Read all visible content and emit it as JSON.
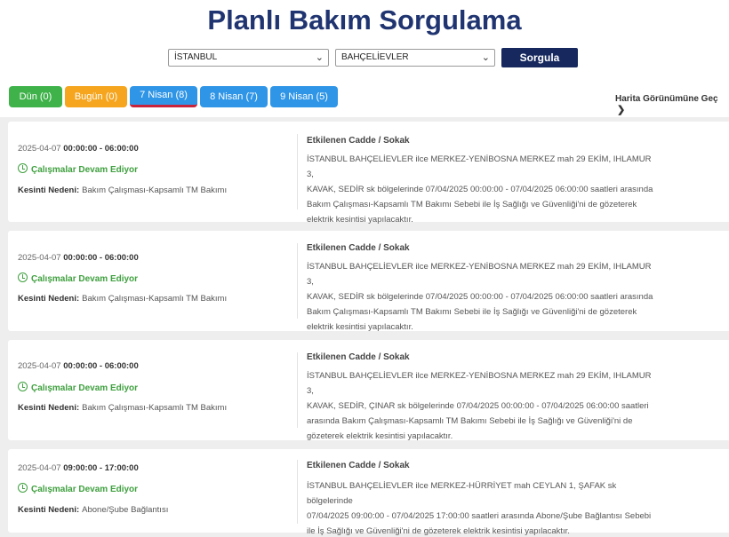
{
  "header": {
    "title": "Planlı Bakım Sorgulama",
    "city_select": "İSTANBUL",
    "district_select": "BAHÇELİEVLER",
    "query_button": "Sorgula"
  },
  "tabs": [
    {
      "label": "Dün (0)",
      "color": "#3fb24a"
    },
    {
      "label": "Bugün (0)",
      "color": "#f5a51e"
    },
    {
      "label": "7 Nisan (8)",
      "color": "#2f95e6",
      "active": true
    },
    {
      "label": "8 Nisan (7)",
      "color": "#2f95e6"
    },
    {
      "label": "9 Nisan (5)",
      "color": "#2f95e6"
    }
  ],
  "map_link": "Harita Görünümüne Geç",
  "labels": {
    "street": "Etkilenen Cadde / Sokak",
    "reason": "Kesinti Nedeni:"
  },
  "cards": [
    {
      "date": "2025-04-07",
      "time": "00:00:00 - 06:00:00",
      "status": "Çalışmalar Devam Ediyor",
      "reason": "Bakım Çalışması-Kapsamlı TM Bakımı",
      "lines": [
        "İSTANBUL BAHÇELİEVLER ilce MERKEZ-YENİBOSNA MERKEZ mah 29 EKİM, IHLAMUR 3,",
        "KAVAK, SEDİR sk bölgelerinde 07/04/2025 00:00:00 - 07/04/2025 06:00:00 saatleri arasında",
        "Bakım Çalışması-Kapsamlı TM Bakımı Sebebi ile İş Sağlığı ve Güvenliği'ni de gözeterek",
        "elektrik kesintisi yapılacaktır."
      ]
    },
    {
      "date": "2025-04-07",
      "time": "00:00:00 - 06:00:00",
      "status": "Çalışmalar Devam Ediyor",
      "reason": "Bakım Çalışması-Kapsamlı TM Bakımı",
      "lines": [
        "İSTANBUL BAHÇELİEVLER ilce MERKEZ-YENİBOSNA MERKEZ mah 29 EKİM, IHLAMUR 3,",
        "KAVAK, SEDİR sk bölgelerinde 07/04/2025 00:00:00 - 07/04/2025 06:00:00 saatleri arasında",
        "Bakım Çalışması-Kapsamlı TM Bakımı Sebebi ile İş Sağlığı ve Güvenliği'ni de gözeterek",
        "elektrik kesintisi yapılacaktır."
      ]
    },
    {
      "date": "2025-04-07",
      "time": "00:00:00 - 06:00:00",
      "status": "Çalışmalar Devam Ediyor",
      "reason": "Bakım Çalışması-Kapsamlı TM Bakımı",
      "lines": [
        "İSTANBUL BAHÇELİEVLER ilce MERKEZ-YENİBOSNA MERKEZ mah 29 EKİM, IHLAMUR 3,",
        "KAVAK, SEDİR, ÇINAR sk bölgelerinde 07/04/2025 00:00:00 - 07/04/2025 06:00:00 saatleri",
        "arasında Bakım Çalışması-Kapsamlı TM Bakımı Sebebi ile İş Sağlığı ve Güvenliği'ni de",
        "gözeterek elektrik kesintisi yapılacaktır."
      ]
    },
    {
      "date": "2025-04-07",
      "time": "09:00:00 - 17:00:00",
      "status": "Çalışmalar Devam Ediyor",
      "reason": "Abone/Şube Bağlantısı",
      "lines": [
        "İSTANBUL BAHÇELİEVLER ilce MERKEZ-HÜRRİYET mah CEYLAN 1, ŞAFAK sk bölgelerinde",
        "07/04/2025 09:00:00 - 07/04/2025 17:00:00 saatleri arasında Abone/Şube Bağlantısı Sebebi",
        "ile İş Sağlığı ve Güvenliği'ni de gözeterek elektrik kesintisi yapılacaktır."
      ]
    }
  ]
}
